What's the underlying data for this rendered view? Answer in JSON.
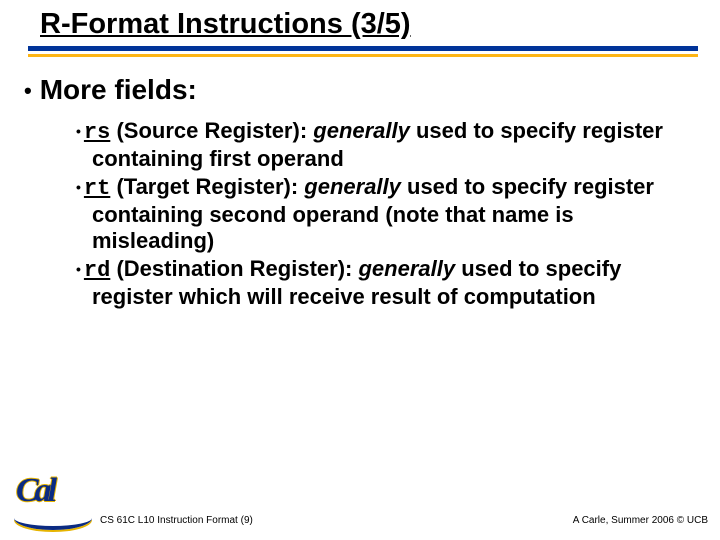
{
  "title": "R-Format Instructions (3/5)",
  "heading": "More fields:",
  "items": [
    {
      "code": "rs",
      "label": "(Source Register): ",
      "gen": "generally",
      "rest": " used to specify register containing first operand"
    },
    {
      "code": "rt",
      "label": "(Target Register): ",
      "gen": "generally",
      "rest": " used to specify register containing second operand (note that name is misleading)"
    },
    {
      "code": "rd",
      "label": "(Destination Register): ",
      "gen": "generally",
      "rest": " used to specify register which will receive result of computation"
    }
  ],
  "logo_text": "Cal",
  "footer_left": "CS 61C L10 Instruction Format (9)",
  "footer_right": "A Carle, Summer 2006 © UCB"
}
